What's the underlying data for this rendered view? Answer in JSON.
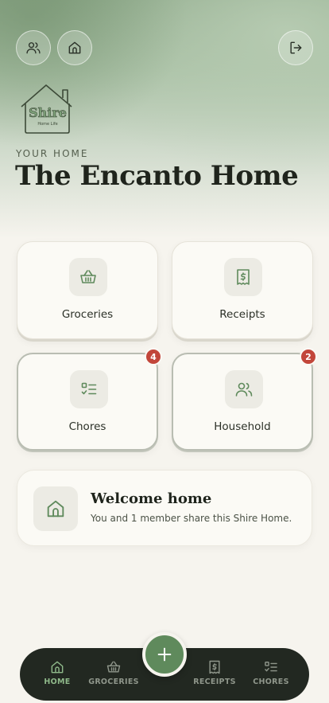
{
  "header": {
    "eyebrow": "YOUR HOME",
    "home_name": "The Encanto Home",
    "logo_text": "Shire",
    "logo_subtext": "Home Life"
  },
  "top_buttons": {
    "members_icon": "users-icon",
    "home_icon": "house-icon",
    "logout_icon": "logout-icon"
  },
  "cards": [
    {
      "label": "Groceries",
      "icon": "basket-icon",
      "badge": null
    },
    {
      "label": "Receipts",
      "icon": "receipt-icon",
      "badge": null
    },
    {
      "label": "Chores",
      "icon": "checklist-icon",
      "badge": "4"
    },
    {
      "label": "Household",
      "icon": "users-icon",
      "badge": "2"
    }
  ],
  "welcome": {
    "title": "Welcome home",
    "subtitle": "You and 1 member share this Shire Home."
  },
  "nav": {
    "items": [
      {
        "label": "HOME",
        "icon": "house-icon",
        "active": true
      },
      {
        "label": "GROCERIES",
        "icon": "basket-icon",
        "active": false
      },
      {
        "label": "RECEIPTS",
        "icon": "receipt-icon",
        "active": false
      },
      {
        "label": "CHORES",
        "icon": "checklist-icon",
        "active": false
      }
    ],
    "fab_icon": "plus-icon"
  },
  "colors": {
    "accent": "#5f8a5c",
    "nav_active": "#8fb98a",
    "badge": "#c2463a",
    "nav_bg": "#222821"
  }
}
